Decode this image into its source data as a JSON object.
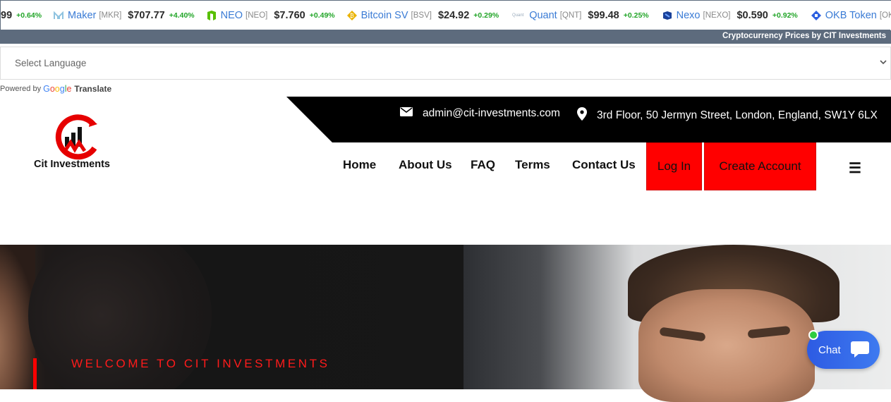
{
  "ticker": {
    "lead_fragment": "99",
    "lead_change": "+0.64%",
    "items": [
      {
        "name": "Maker",
        "symbol": "[MKR]",
        "price": "$707.77",
        "change": "+4.40%",
        "icon": "maker-icon",
        "icon_color": "#8fc3e0"
      },
      {
        "name": "NEO",
        "symbol": "[NEO]",
        "price": "$7.760",
        "change": "+0.49%",
        "icon": "neo-icon",
        "icon_color": "#58bf00"
      },
      {
        "name": "Bitcoin SV",
        "symbol": "[BSV]",
        "price": "$24.92",
        "change": "+0.29%",
        "icon": "bitcoin-sv-icon",
        "icon_color": "#eab300"
      },
      {
        "name": "Quant",
        "symbol": "[QNT]",
        "price": "$99.48",
        "change": "+0.25%",
        "icon": "quant-icon",
        "icon_color": "#9ab"
      },
      {
        "name": "Nexo",
        "symbol": "[NEXO]",
        "price": "$0.590",
        "change": "+0.92%",
        "icon": "nexo-icon",
        "icon_color": "#1a4199"
      },
      {
        "name": "OKB Token",
        "symbol": "[OKB]",
        "price": "",
        "change": "",
        "icon": "okb-icon",
        "icon_color": "#2d60e0"
      }
    ],
    "footer": "Cryptocurrency Prices by CIT Investments"
  },
  "language": {
    "placeholder": "Select Language",
    "powered_by": "Powered by",
    "google_letters": [
      "G",
      "o",
      "o",
      "g",
      "l",
      "e"
    ],
    "translate": "Translate"
  },
  "header": {
    "email": "admin@cit-investments.com",
    "address": "3rd Floor, 50 Jermyn Street, London, England, SW1Y 6LX",
    "brand": "Cit Investments",
    "nav": [
      "Home",
      "About Us",
      "FAQ",
      "Terms",
      "Contact Us"
    ],
    "login": "Log In",
    "create_account": "Create Account",
    "menu_glyph": "☰"
  },
  "hero": {
    "welcome": "WELCOME TO CIT INVESTMENTS"
  },
  "chat": {
    "label": "Chat"
  },
  "colors": {
    "accent_red": "#ff0000",
    "ticker_footer": "#5d6b7d",
    "change_green": "#22a528",
    "chat_blue": "#2d5be3"
  }
}
